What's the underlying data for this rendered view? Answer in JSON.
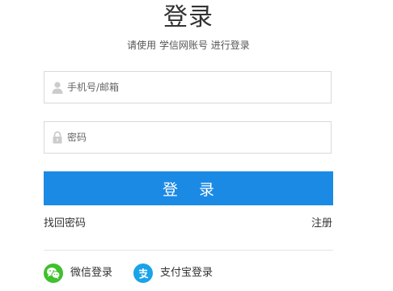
{
  "header": {
    "title": "登录",
    "subtitle": "请使用 学信网账号 进行登录"
  },
  "form": {
    "username_placeholder": "手机号/邮箱",
    "username_value": "",
    "password_placeholder": "密码",
    "password_value": "",
    "submit_label": "登 录"
  },
  "links": {
    "forgot_password": "找回密码",
    "register": "注册"
  },
  "social": {
    "wechat_label": "微信登录",
    "alipay_label": "支付宝登录"
  },
  "icons": {
    "username": "user-icon",
    "password": "lock-icon",
    "wechat": "wechat-icon",
    "alipay": "alipay-icon"
  },
  "colors": {
    "primary": "#1a8ae5",
    "wechat": "#3ec12b",
    "alipay": "#1aa3e8"
  }
}
